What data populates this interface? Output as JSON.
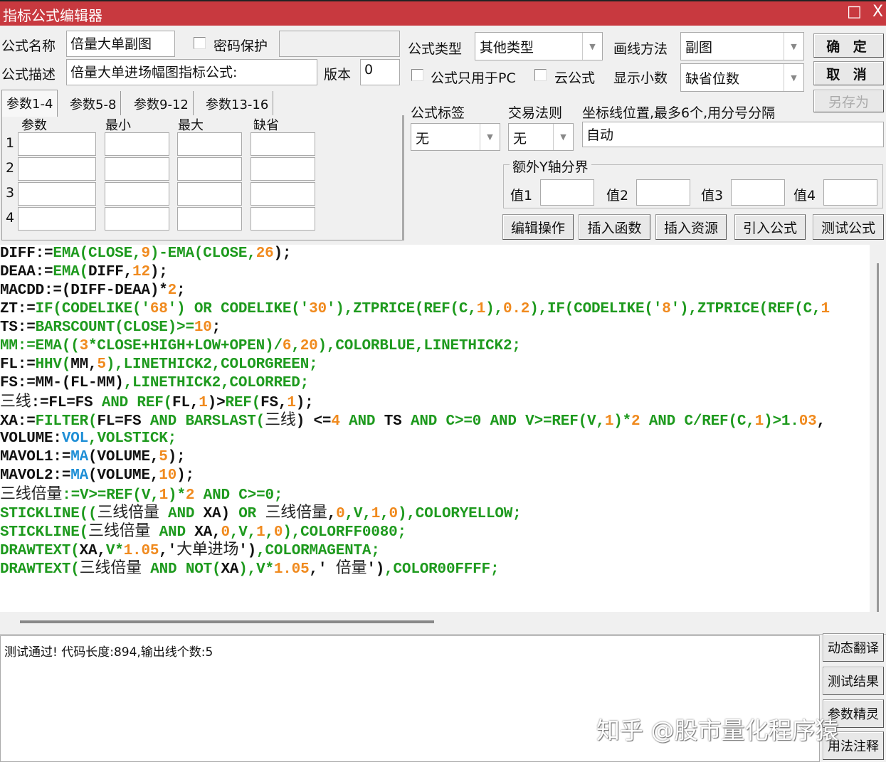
{
  "window": {
    "title": "指标公式编辑器",
    "maximize_icon": "□",
    "close_icon": "X"
  },
  "form": {
    "name_label": "公式名称",
    "name_value": "倍量大单副图",
    "password_label": "密码保护",
    "password_value": "",
    "desc_label": "公式描述",
    "desc_value": "倍量大单进场幅图指标公式:",
    "version_label": "版本",
    "version_value": "0",
    "type_label": "公式类型",
    "type_value": "其他类型",
    "draw_label": "画线方法",
    "draw_value": "副图",
    "pc_only_label": "公式只用于PC",
    "cloud_label": "云公式",
    "decimals_label": "显示小数",
    "decimals_value": "缺省位数",
    "tag_label": "公式标签",
    "tag_value": "无",
    "rule_label": "交易法则",
    "rule_value": "无",
    "axis_label": "坐标线位置,最多6个,用分号分隔",
    "axis_value": "自动",
    "yaxis_group": "额外Y轴分界",
    "y_values": [
      "值1",
      "值2",
      "值3",
      "值4"
    ]
  },
  "buttons": {
    "ok": "确 定",
    "cancel": "取 消",
    "save_as": "另存为"
  },
  "tabs": [
    "参数1-4",
    "参数5-8",
    "参数9-12",
    "参数13-16"
  ],
  "param_headers": [
    "参数",
    "最小",
    "最大",
    "缺省"
  ],
  "param_rows": [
    "1",
    "2",
    "3",
    "4"
  ],
  "toolbar": [
    "编辑操作",
    "插入函数",
    "插入资源",
    "引入公式",
    "测试公式"
  ],
  "code_lines": [
    [
      [
        "k",
        "DIFF:="
      ],
      [
        "g",
        "EMA(CLOSE,"
      ],
      [
        "o",
        "9"
      ],
      [
        "g",
        ")-EMA(CLOSE,"
      ],
      [
        "o",
        "26"
      ],
      [
        "k",
        ");"
      ]
    ],
    [
      [
        "k",
        "DEAA:="
      ],
      [
        "g",
        "EMA("
      ],
      [
        "k",
        "DIFF,"
      ],
      [
        "o",
        "12"
      ],
      [
        "k",
        ");"
      ]
    ],
    [
      [
        "k",
        "MACDD:=(DIFF-DEAA)*"
      ],
      [
        "o",
        "2"
      ],
      [
        "k",
        ";"
      ]
    ],
    [
      [
        "k",
        "ZT:="
      ],
      [
        "g",
        "IF(CODELIKE('"
      ],
      [
        "o",
        "68"
      ],
      [
        "g",
        "') OR CODELIKE('"
      ],
      [
        "o",
        "30"
      ],
      [
        "g",
        "'),ZTPRICE(REF(C,"
      ],
      [
        "o",
        "1"
      ],
      [
        "g",
        "),"
      ],
      [
        "o",
        "0.2"
      ],
      [
        "g",
        "),IF(CODELIKE('"
      ],
      [
        "o",
        "8"
      ],
      [
        "g",
        "'),ZTPRICE(REF(C,"
      ],
      [
        "o",
        "1"
      ]
    ],
    [
      [
        "k",
        "TS:="
      ],
      [
        "g",
        "BARSCOUNT(CLOSE)>="
      ],
      [
        "o",
        "10"
      ],
      [
        "k",
        ";"
      ]
    ],
    [
      [
        "g",
        "MM:=EMA(("
      ],
      [
        "o",
        "3"
      ],
      [
        "g",
        "*CLOSE+HIGH+LOW+OPEN)/"
      ],
      [
        "o",
        "6"
      ],
      [
        "g",
        ","
      ],
      [
        "o",
        "20"
      ],
      [
        "g",
        "),COLORBLUE,LINETHICK2;"
      ]
    ],
    [
      [
        "k",
        "FL:="
      ],
      [
        "g",
        "HHV("
      ],
      [
        "k",
        "MM,"
      ],
      [
        "o",
        "5"
      ],
      [
        "g",
        "),LINETHICK2,COLORGREEN;"
      ]
    ],
    [
      [
        "k",
        "FS:=MM-(FL-MM)"
      ],
      [
        "g",
        ",LINETHICK2,COLORRED;"
      ]
    ],
    [
      [
        "c",
        "三线"
      ],
      [
        "k",
        ":=FL=FS "
      ],
      [
        "g",
        "AND REF("
      ],
      [
        "k",
        "FL,"
      ],
      [
        "o",
        "1"
      ],
      [
        "k",
        ")>"
      ],
      [
        "g",
        "REF("
      ],
      [
        "k",
        "FS,"
      ],
      [
        "o",
        "1"
      ],
      [
        "k",
        ");"
      ]
    ],
    [
      [
        "k",
        "XA:="
      ],
      [
        "g",
        "FILTER("
      ],
      [
        "k",
        "FL=FS "
      ],
      [
        "g",
        "AND BARSLAST("
      ],
      [
        "c",
        "三线"
      ],
      [
        "k",
        ") <="
      ],
      [
        "o",
        "4"
      ],
      [
        "g",
        " AND "
      ],
      [
        "k",
        "TS "
      ],
      [
        "g",
        "AND C>=0 AND V>=REF(V,"
      ],
      [
        "o",
        "1"
      ],
      [
        "g",
        ")*"
      ],
      [
        "o",
        "2"
      ],
      [
        "g",
        " AND C/REF(C,"
      ],
      [
        "o",
        "1"
      ],
      [
        "g",
        ")>1."
      ],
      [
        "o",
        "03"
      ],
      [
        "k",
        ","
      ]
    ],
    [
      [
        "k",
        "VOLUME:"
      ],
      [
        "b",
        "VOL"
      ],
      [
        "g",
        ",VOLSTICK;"
      ]
    ],
    [
      [
        "k",
        "MAVOL1:="
      ],
      [
        "b",
        "MA"
      ],
      [
        "k",
        "(VOLUME,"
      ],
      [
        "o",
        "5"
      ],
      [
        "k",
        ");"
      ]
    ],
    [
      [
        "k",
        "MAVOL2:="
      ],
      [
        "b",
        "MA"
      ],
      [
        "k",
        "(VOLUME,"
      ],
      [
        "o",
        "10"
      ],
      [
        "k",
        ");"
      ]
    ],
    [
      [
        "c",
        "三线倍量"
      ],
      [
        "g",
        ":=V>=REF(V,"
      ],
      [
        "o",
        "1"
      ],
      [
        "g",
        ")*"
      ],
      [
        "o",
        "2"
      ],
      [
        "g",
        " AND C>=0;"
      ]
    ],
    [
      [
        "g",
        "STICKLINE(("
      ],
      [
        "c",
        "三线倍量"
      ],
      [
        "g",
        " AND "
      ],
      [
        "k",
        "XA) "
      ],
      [
        "g",
        "OR "
      ],
      [
        "c",
        "三线倍量"
      ],
      [
        "k",
        ","
      ],
      [
        "o",
        "0"
      ],
      [
        "g",
        ",V,"
      ],
      [
        "o",
        "1"
      ],
      [
        "g",
        ","
      ],
      [
        "o",
        "0"
      ],
      [
        "g",
        "),COLORYELLOW;"
      ]
    ],
    [
      [
        "g",
        "STICKLINE("
      ],
      [
        "c",
        "三线倍量"
      ],
      [
        "g",
        " AND "
      ],
      [
        "k",
        "XA,"
      ],
      [
        "o",
        "0"
      ],
      [
        "g",
        ",V,"
      ],
      [
        "o",
        "1"
      ],
      [
        "g",
        ","
      ],
      [
        "o",
        "0"
      ],
      [
        "g",
        "),COLORFF0080;"
      ]
    ],
    [
      [
        "g",
        "DRAWTEXT("
      ],
      [
        "k",
        "XA,"
      ],
      [
        "g",
        "V*"
      ],
      [
        "o",
        "1.05"
      ],
      [
        "k",
        ",'"
      ],
      [
        "c",
        "大单进场"
      ],
      [
        "k",
        "')"
      ],
      [
        "g",
        ",COLORMAGENTA;"
      ]
    ],
    [
      [
        "g",
        "DRAWTEXT("
      ],
      [
        "c",
        "三线倍量"
      ],
      [
        "g",
        " AND NOT("
      ],
      [
        "k",
        "XA"
      ],
      [
        "g",
        "),V*"
      ],
      [
        "o",
        "1.05"
      ],
      [
        "k",
        ",' "
      ],
      [
        "c",
        "倍量"
      ],
      [
        "k",
        "')"
      ],
      [
        "g",
        ",COLOR00FFFF;"
      ]
    ]
  ],
  "output": {
    "message": "测试通过! 代码长度:894,输出线个数:5"
  },
  "side_buttons": [
    "动态翻译",
    "测试结果",
    "参数精灵",
    "用法注释"
  ],
  "watermark": "知乎 @股市量化程序猿"
}
